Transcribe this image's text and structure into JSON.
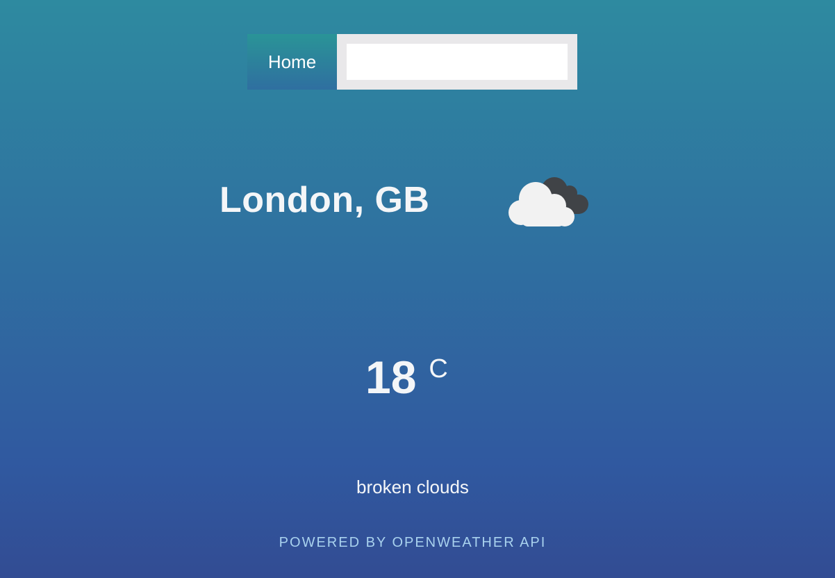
{
  "nav": {
    "home_label": "Home",
    "search": {
      "value": "",
      "placeholder": ""
    }
  },
  "weather": {
    "location": "London, GB",
    "icon": "broken-clouds-icon",
    "temperature": "18",
    "unit": "C",
    "description": "broken clouds"
  },
  "footer": {
    "text": "POWERED BY OPENWEATHER API"
  },
  "colors": {
    "gradient_top": "#2e8aa0",
    "gradient_bottom": "#324c93",
    "footer_text": "#a9d2ee",
    "search_frame": "#e9e8ea",
    "cloud_light": "#f2f2f2",
    "cloud_dark": "#404347"
  }
}
